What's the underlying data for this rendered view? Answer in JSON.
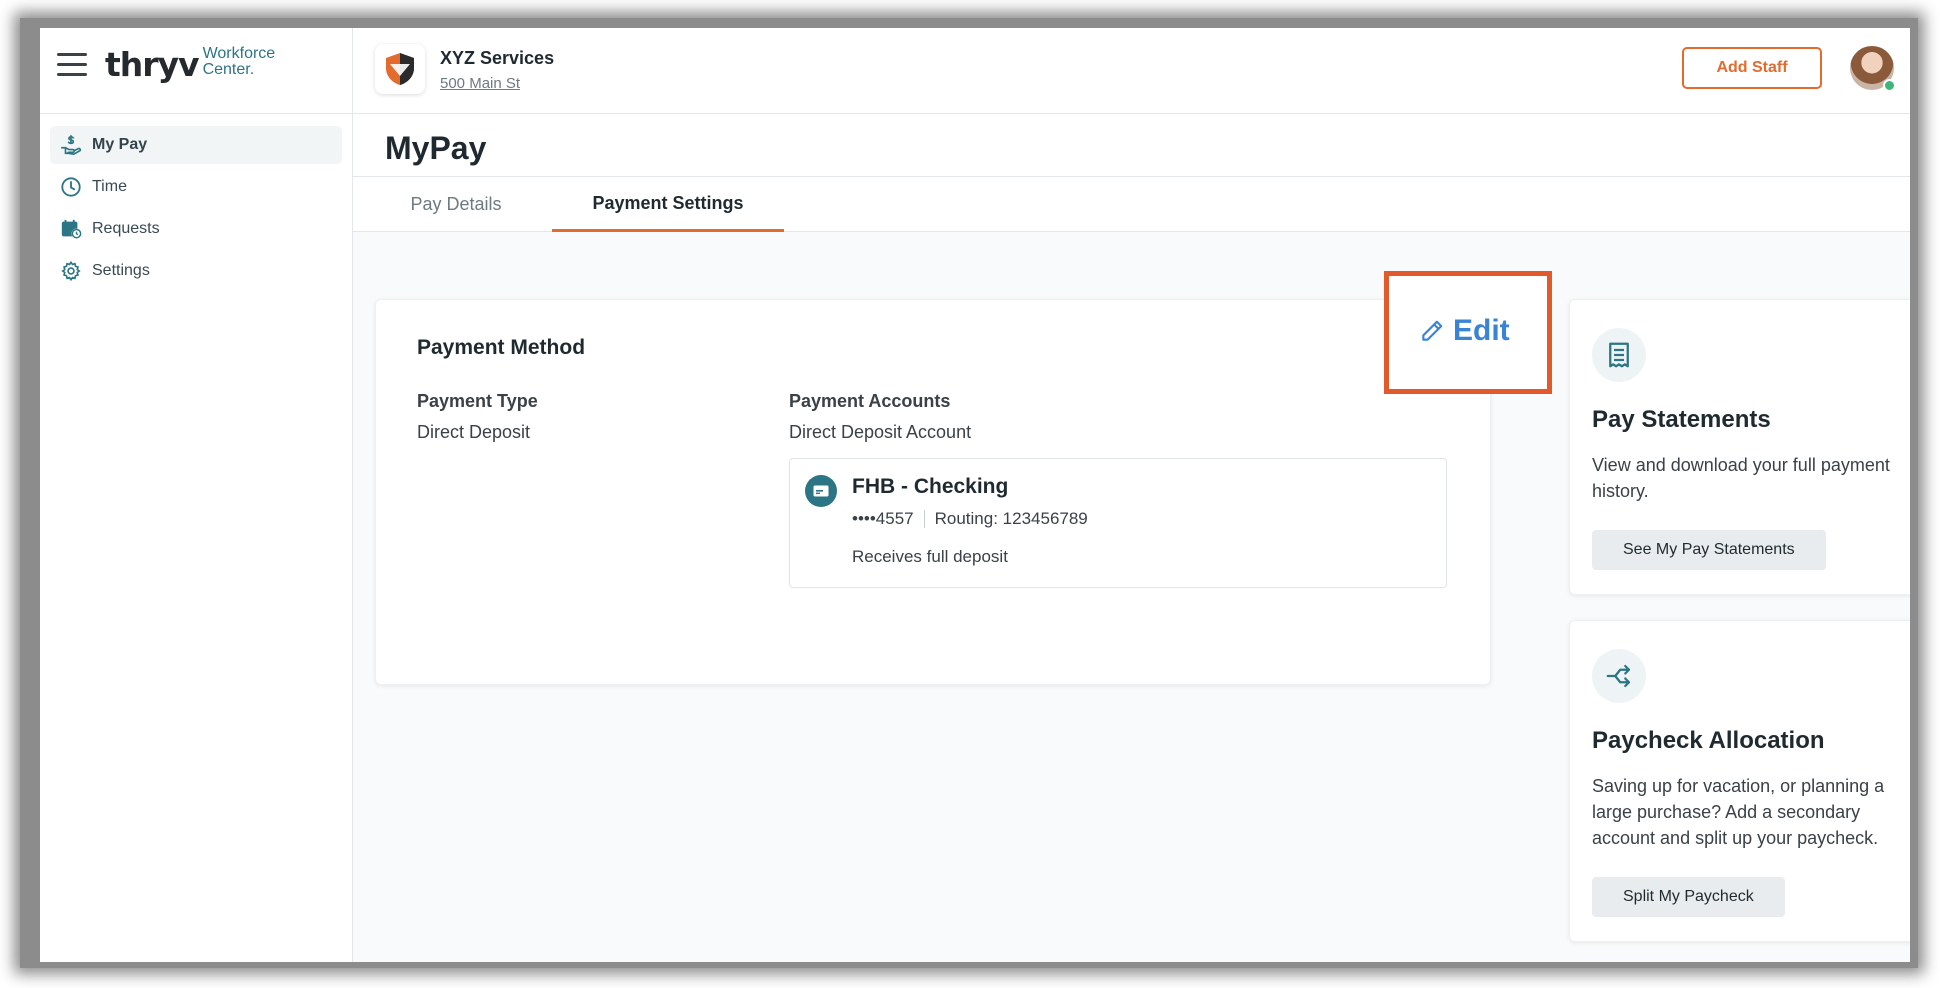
{
  "app": {
    "logo_word": "thryv",
    "logo_sub_line1": "Workforce",
    "logo_sub_line2": "Center."
  },
  "sidebar": {
    "items": [
      {
        "label": "My Pay",
        "icon": "hand-dollar-icon",
        "active": true
      },
      {
        "label": "Time",
        "icon": "clock-icon",
        "active": false
      },
      {
        "label": "Requests",
        "icon": "calendar-clock-icon",
        "active": false
      },
      {
        "label": "Settings",
        "icon": "gear-icon",
        "active": false
      }
    ]
  },
  "header": {
    "company_name": "XYZ Services",
    "company_address": "500 Main St",
    "add_staff_label": "Add Staff"
  },
  "page": {
    "title": "MyPay",
    "tabs": [
      {
        "label": "Pay Details",
        "active": false
      },
      {
        "label": "Payment Settings",
        "active": true
      }
    ]
  },
  "payment_method": {
    "title": "Payment Method",
    "edit_label": "Edit",
    "payment_type_label": "Payment Type",
    "payment_type_value": "Direct Deposit",
    "payment_accounts_label": "Payment Accounts",
    "payment_accounts_value": "Direct Deposit Account",
    "account": {
      "name": "FHB - Checking",
      "masked_number": "••••4557",
      "routing": "Routing: 123456789",
      "note": "Receives full deposit"
    }
  },
  "pay_statements": {
    "title": "Pay Statements",
    "description": "View and download your full payment history.",
    "button_label": "See My Pay Statements"
  },
  "paycheck_allocation": {
    "title": "Paycheck Allocation",
    "description": "Saving up for vacation, or planning a large purchase? Add a secondary account and split up your paycheck.",
    "button_label": "Split My Paycheck"
  },
  "colors": {
    "accent_orange": "#e46b2e",
    "teal": "#2c7585",
    "edit_blue": "#3a84d6",
    "highlight_red": "#e2592b"
  }
}
